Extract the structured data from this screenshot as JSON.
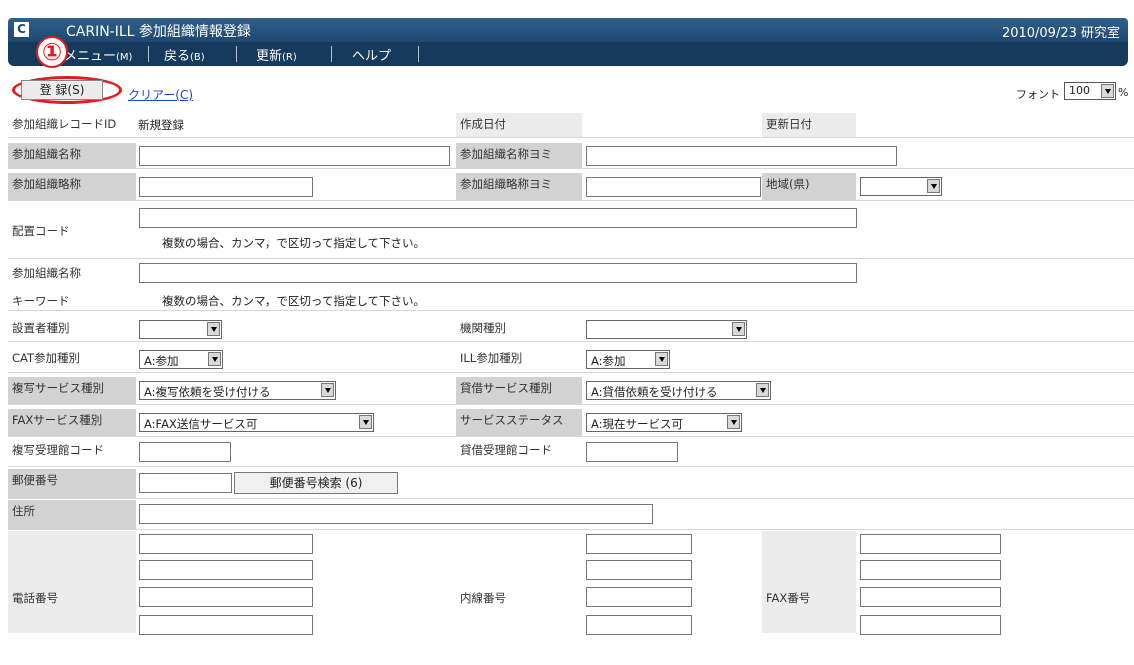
{
  "window": {
    "title": "CARIN-ILL 参加組織情報登録",
    "date_info": "2010/09/23 研究室"
  },
  "menu": {
    "items": [
      {
        "label": "メニュー",
        "key": "(M)"
      },
      {
        "label": "戻る",
        "key": "(B)"
      },
      {
        "label": "更新",
        "key": "(R)"
      },
      {
        "label": "ヘルプ",
        "key": ""
      }
    ]
  },
  "annotation": {
    "number": "①",
    "color": "#e21c1c"
  },
  "toolbar": {
    "register_label": "登 録(S)",
    "clear_label": "クリアー(C)",
    "font_label": "フォント",
    "font_value": "100",
    "font_unit": "%"
  },
  "form": {
    "record_id_label": "参加組織レコードID",
    "record_id_value": "新規登録",
    "created_label": "作成日付",
    "updated_label": "更新日付",
    "org_name_label": "参加組織名称",
    "org_name_kana_label": "参加組織名称ヨミ",
    "org_abbr_label": "参加組織略称",
    "org_abbr_kana_label": "参加組織略称ヨミ",
    "region_label": "地域(県)",
    "placement_label": "配置コード",
    "placement_hint": "複数の場合、カンマ，で区切って指定して下さい。",
    "keyword_label_1": "参加組織名称",
    "keyword_label_2": "キーワード",
    "keyword_hint": "複数の場合、カンマ，で区切って指定して下さい。",
    "founder_label": "設置者種別",
    "institution_label": "機関種別",
    "cat_label": "CAT参加種別",
    "cat_value": "A:参加",
    "ill_label": "ILL参加種別",
    "ill_value": "A:参加",
    "copy_service_label": "複写サービス種別",
    "copy_service_value": "A:複写依頼を受け付ける",
    "loan_service_label": "貸借サービス種別",
    "loan_service_value": "A:貸借依頼を受け付ける",
    "fax_service_label": "FAXサービス種別",
    "fax_service_value": "A:FAX送信サービス可",
    "service_status_label": "サービスステータス",
    "service_status_value": "A:現在サービス可",
    "copy_receiver_label": "複写受理館コード",
    "loan_receiver_label": "貸借受理館コード",
    "postal_label": "郵便番号",
    "postal_search_label": "郵便番号検索 (6)",
    "address_label": "住所",
    "phone_label": "電話番号",
    "extension_label": "内線番号",
    "fax_label": "FAX番号"
  }
}
